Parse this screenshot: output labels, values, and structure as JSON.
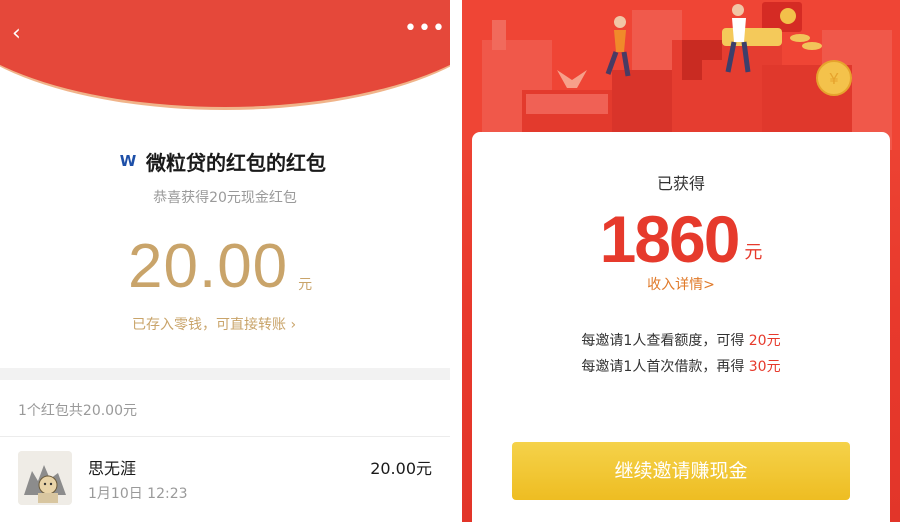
{
  "left": {
    "nav": {
      "back_icon": "‹",
      "more_icon": "•••"
    },
    "sender": {
      "brand_icon_letter": "W",
      "title": "微粒贷的红包的红包"
    },
    "subtitle": "恭喜获得20元现金红包",
    "amount": {
      "value": "20.00",
      "unit": "元"
    },
    "saved_link": "已存入零钱，可直接转账 ›",
    "summary": "1个红包共20.00元",
    "recipient": {
      "name": "思无涯",
      "time": "1月10日  12:23",
      "amount": "20.00元"
    }
  },
  "right": {
    "earned_label": "已获得",
    "earned_amount": "1860",
    "earned_unit": "元",
    "income_link": "收入详情>",
    "rules": [
      {
        "text": "每邀请1人查看额度，可得 ",
        "highlight": "20元"
      },
      {
        "text": "每邀请1人首次借款，再得 ",
        "highlight": "30元"
      }
    ],
    "cta_label": "继续邀请赚现金"
  },
  "colors": {
    "red": "#e5483a",
    "gold": "#c9a46a",
    "highlight_red": "#e63a2c",
    "link_orange": "#e07a2a",
    "cta_yellow": "#f0c22e"
  }
}
